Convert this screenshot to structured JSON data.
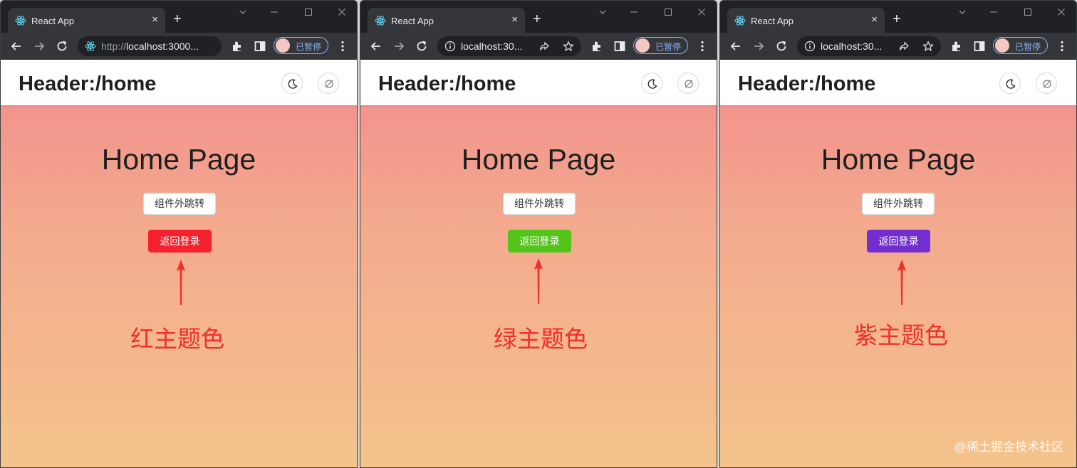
{
  "windows": [
    {
      "tab_title": "React App",
      "tab_close": "×",
      "new_tab": "+",
      "url_host": "http://",
      "url_main": "localhost:3000...",
      "omni_icon": "react-icon",
      "show_share": false,
      "profile_label": "已暂停",
      "header_title": "Header:/home",
      "home_title": "Home Page",
      "outline_button": "组件外跳转",
      "primary_button": "返回登录",
      "primary_color": "#f5222d",
      "annotation": "红主题色"
    },
    {
      "tab_title": "React App",
      "tab_close": "×",
      "new_tab": "+",
      "url_host": "",
      "url_main": "localhost:30...",
      "omni_icon": "info-icon",
      "show_share": true,
      "profile_label": "已暂停",
      "header_title": "Header:/home",
      "home_title": "Home Page",
      "outline_button": "组件外跳转",
      "primary_button": "返回登录",
      "primary_color": "#52c41a",
      "annotation": "绿主题色"
    },
    {
      "tab_title": "React App",
      "tab_close": "×",
      "new_tab": "+",
      "url_host": "",
      "url_main": "localhost:30...",
      "omni_icon": "info-icon",
      "show_share": true,
      "profile_label": "已暂停",
      "header_title": "Header:/home",
      "home_title": "Home Page",
      "outline_button": "组件外跳转",
      "primary_button": "返回登录",
      "primary_color": "#722ed1",
      "annotation": "紫主题色"
    }
  ],
  "watermark": "@稀土掘金技术社区",
  "annotation_color": "#f02f2a"
}
